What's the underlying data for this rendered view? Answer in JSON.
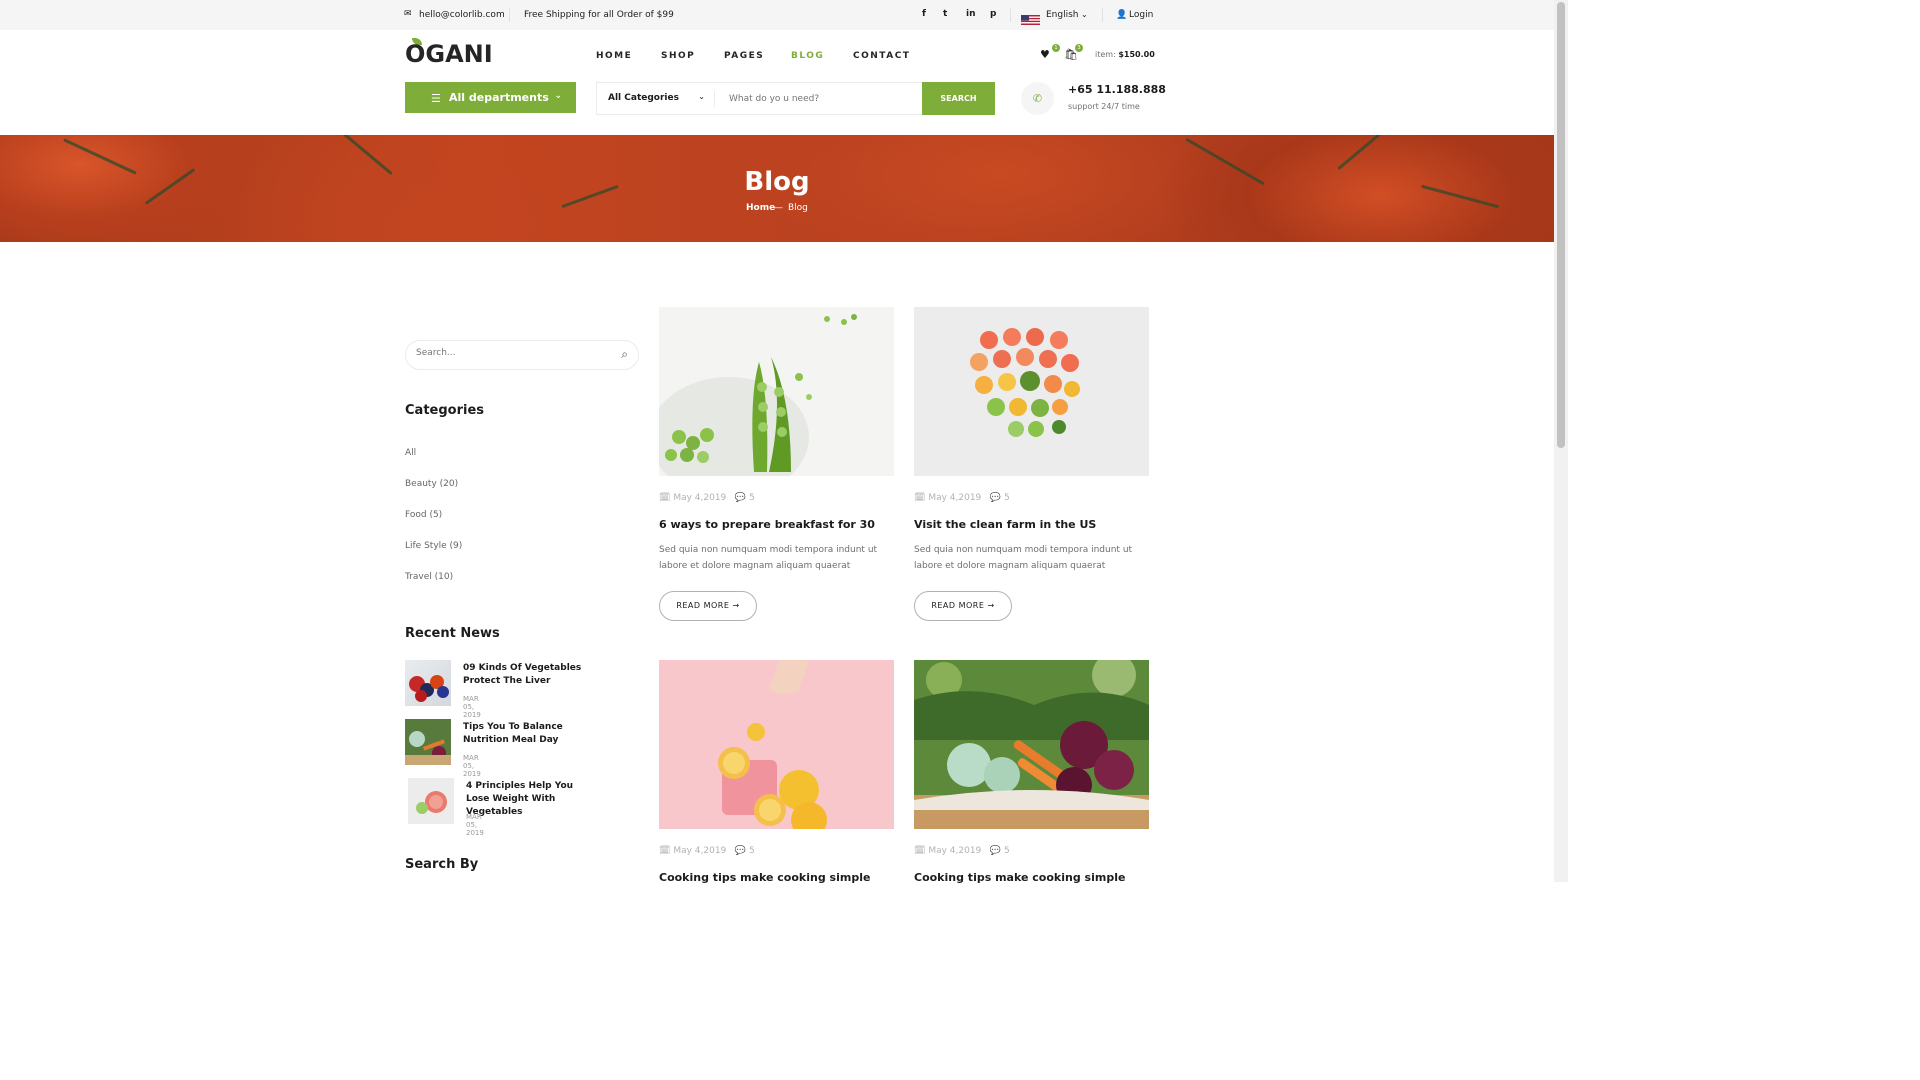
{
  "topbar": {
    "email": "hello@colorlib.com",
    "shipping": "Free Shipping for all Order of $99",
    "social": [
      "f",
      "t",
      "in",
      "p"
    ],
    "language": "English",
    "login": "Login"
  },
  "header": {
    "logo": "OGANI",
    "nav": [
      "HOME",
      "SHOP",
      "PAGES",
      "BLOG",
      "CONTACT"
    ],
    "active_nav": "BLOG",
    "wishlist_count": "1",
    "cart_count": "3",
    "item_label": "item:",
    "item_total": "$150.00"
  },
  "search_bar": {
    "departments": "All departments",
    "category": "All Categories",
    "placeholder": "What do yo u need?",
    "button": "SEARCH",
    "phone": "+65 11.188.888",
    "support": "support 24/7 time"
  },
  "hero": {
    "title": "Blog",
    "breadcrumb_home": "Home",
    "breadcrumb_sep": "—",
    "breadcrumb_current": "Blog"
  },
  "sidebar": {
    "search_placeholder": "Search...",
    "categories_title": "Categories",
    "categories": [
      "All",
      "Beauty (20)",
      "Food (5)",
      "Life Style (9)",
      "Travel (10)"
    ],
    "recent_title": "Recent News",
    "recent": [
      {
        "title": "09 Kinds Of Vegetables Protect The Liver",
        "date": "MAR 05, 2019"
      },
      {
        "title": "Tips You To Balance Nutrition Meal Day",
        "date": "MAR 05, 2019"
      },
      {
        "title": "4 Principles Help You Lose Weight With Vegetables",
        "date": "MAR 05, 2019"
      }
    ],
    "search_by_title": "Search By"
  },
  "posts": [
    {
      "date": "May 4,2019",
      "comments": "5",
      "title": "6 ways to prepare breakfast for 30",
      "desc": "Sed quia non numquam modi tempora indunt ut labore et dolore magnam aliquam quaerat",
      "button": "READ MORE"
    },
    {
      "date": "May 4,2019",
      "comments": "5",
      "title": "Visit the clean farm in the US",
      "desc": "Sed quia non numquam modi tempora indunt ut labore et dolore magnam aliquam quaerat",
      "button": "READ MORE"
    },
    {
      "date": "May 4,2019",
      "comments": "5",
      "title": "Cooking tips make cooking simple",
      "desc": "",
      "button": ""
    },
    {
      "date": "May 4,2019",
      "comments": "5",
      "title": "Cooking tips make cooking simple",
      "desc": "",
      "button": ""
    }
  ],
  "colors": {
    "accent": "#7fad39",
    "text": "#1c1c1c",
    "muted": "#6f6f6f"
  }
}
